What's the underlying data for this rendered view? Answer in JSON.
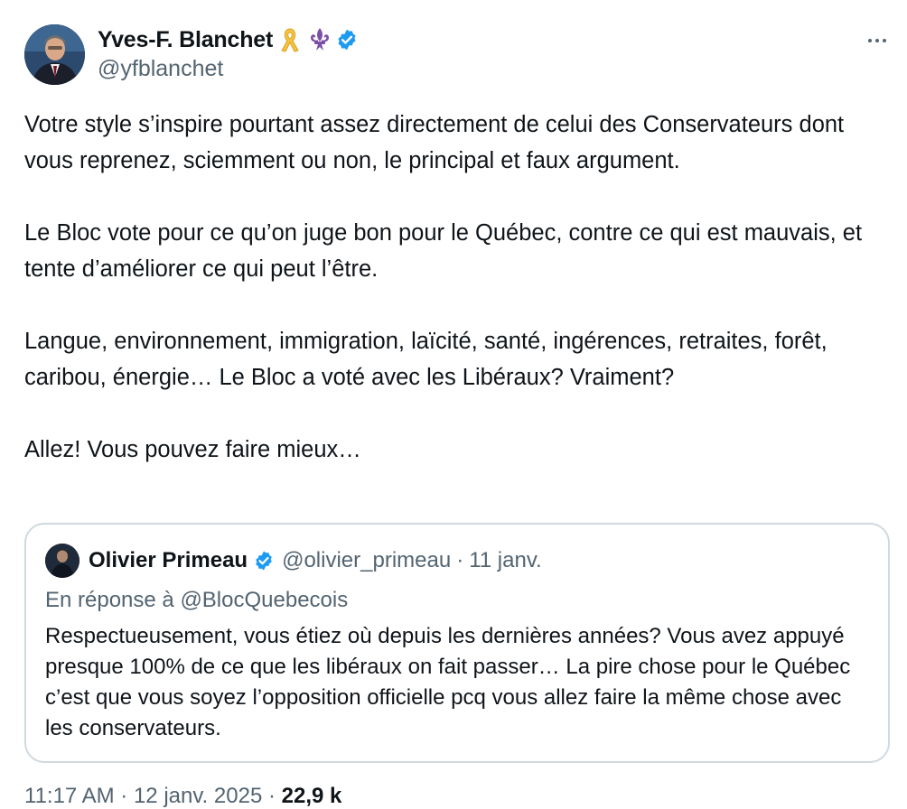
{
  "author": {
    "display_name": "Yves-F. Blanchet",
    "handle": "@yfblanchet",
    "badges": [
      "yellow-ribbon-icon",
      "fleur-de-lis-icon",
      "verified-badge-icon"
    ]
  },
  "menu": {
    "icon": "more-options-icon"
  },
  "tweet": {
    "paragraphs": [
      "Votre style s’inspire pourtant assez directement de celui des Conservateurs dont vous reprenez, sciemment ou non, le principal et faux argument.",
      "Le Bloc vote pour ce qu’on juge bon pour le Québec, contre ce qui est mauvais, et tente d’améliorer ce qui peut l’être.",
      "Langue, environnement, immigration, laïcité, santé, ingérences, retraites, forêt, caribou, énergie… Le Bloc a voté avec les Libéraux? Vraiment?",
      "Allez! Vous pouvez faire mieux…"
    ]
  },
  "quoted": {
    "display_name": "Olivier Primeau",
    "handle": "@olivier_primeau",
    "separator": "·",
    "date": "11 janv.",
    "reply_to": "En réponse à @BlocQuebecois",
    "text": "Respectueusement, vous étiez où depuis les dernières années? Vous avez appuyé presque 100% de ce que les libéraux on fait passer… La pire chose pour le Québec c’est que vous soyez l’opposition officielle pcq vous allez faire la même chose avec les conservateurs."
  },
  "footer": {
    "timestamp_partial": "11:17 AM · 12 janv. 2025 ·",
    "views_partial": "22,9 k"
  },
  "colors": {
    "text_primary": "#0f1419",
    "text_secondary": "#536471",
    "verified_blue": "#1d9bf0",
    "border": "#cfd9de",
    "ribbon_yellow": "#f5c242",
    "fleur_purple": "#7b4fa8"
  }
}
